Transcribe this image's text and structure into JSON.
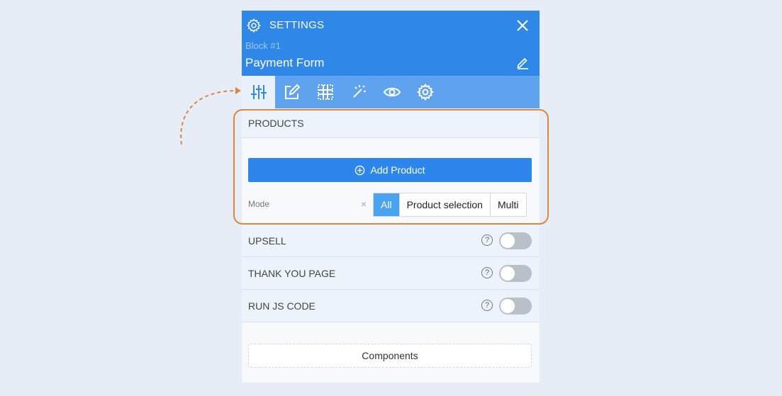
{
  "header": {
    "title": "SETTINGS",
    "block_label": "Block #1",
    "block_name": "Payment Form"
  },
  "toolbar": {
    "tools": [
      {
        "name": "sliders-icon",
        "active": true
      },
      {
        "name": "edit-icon",
        "active": false
      },
      {
        "name": "grid-icon",
        "active": false
      },
      {
        "name": "magic-wand-icon",
        "active": false
      },
      {
        "name": "eye-icon",
        "active": false
      },
      {
        "name": "gear-icon",
        "active": false
      }
    ]
  },
  "products": {
    "heading": "PRODUCTS",
    "add_label": "Add Product",
    "mode_label": "Mode",
    "clear_symbol": "×",
    "mode_options": [
      "All",
      "Product selection",
      "Multi"
    ],
    "selected_mode": "All"
  },
  "sections": [
    {
      "label": "UPSELL",
      "help": "?",
      "enabled": false
    },
    {
      "label": "THANK YOU PAGE",
      "help": "?",
      "enabled": false
    },
    {
      "label": "RUN JS CODE",
      "help": "?",
      "enabled": false
    }
  ],
  "components_label": "Components",
  "colors": {
    "header_blue": "#2f88e8",
    "toolbar_blue": "#5fa3ef",
    "button_blue": "#2d86ec",
    "highlight_orange": "#e2843b",
    "background": "#e6edf7"
  }
}
